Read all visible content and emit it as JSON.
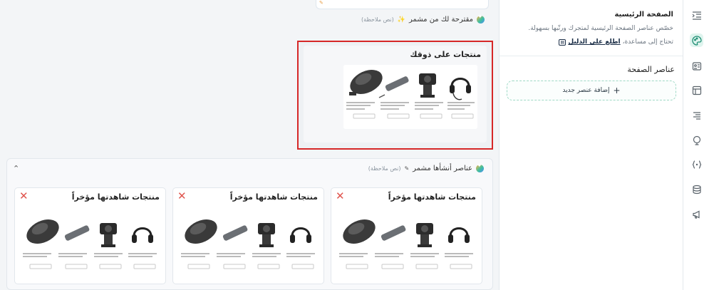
{
  "canvas": {
    "suggested": {
      "title": "مقترحة لك من مشمر",
      "note": "(نص ملاحظة)"
    },
    "suggest_card": {
      "title": "منتجات على ذوقك"
    },
    "generated": {
      "title": "عناصر أنشأها مشمر",
      "note": "(نص ملاحظة)",
      "cards": [
        {
          "title": "منتجات شاهدتها مؤخراً"
        },
        {
          "title": "منتجات شاهدتها مؤخراً"
        },
        {
          "title": "منتجات شاهدتها مؤخراً"
        }
      ]
    }
  },
  "panel": {
    "title": "الصفحة الرئيسية",
    "description": "خصّص عناصر الصفحة الرئيسية لمتجرك ورتّبها بسهولة.",
    "help_prefix": "تحتاج إلى مساعدة،",
    "help_link": "اطلع على الدليل",
    "section_title": "عناصر الصفحة",
    "add_button": "إضافة عنصر جديد"
  },
  "rail": {
    "icons": [
      "menu-collapse-icon",
      "palette-icon",
      "contact-card-icon",
      "layout-icon",
      "align-right-icon",
      "monitor-icon",
      "code-braces-icon",
      "database-icon",
      "megaphone-icon"
    ]
  },
  "colors": {
    "accent": "#1f8f74",
    "highlight_border": "#d62828",
    "close": "#e0554e"
  }
}
